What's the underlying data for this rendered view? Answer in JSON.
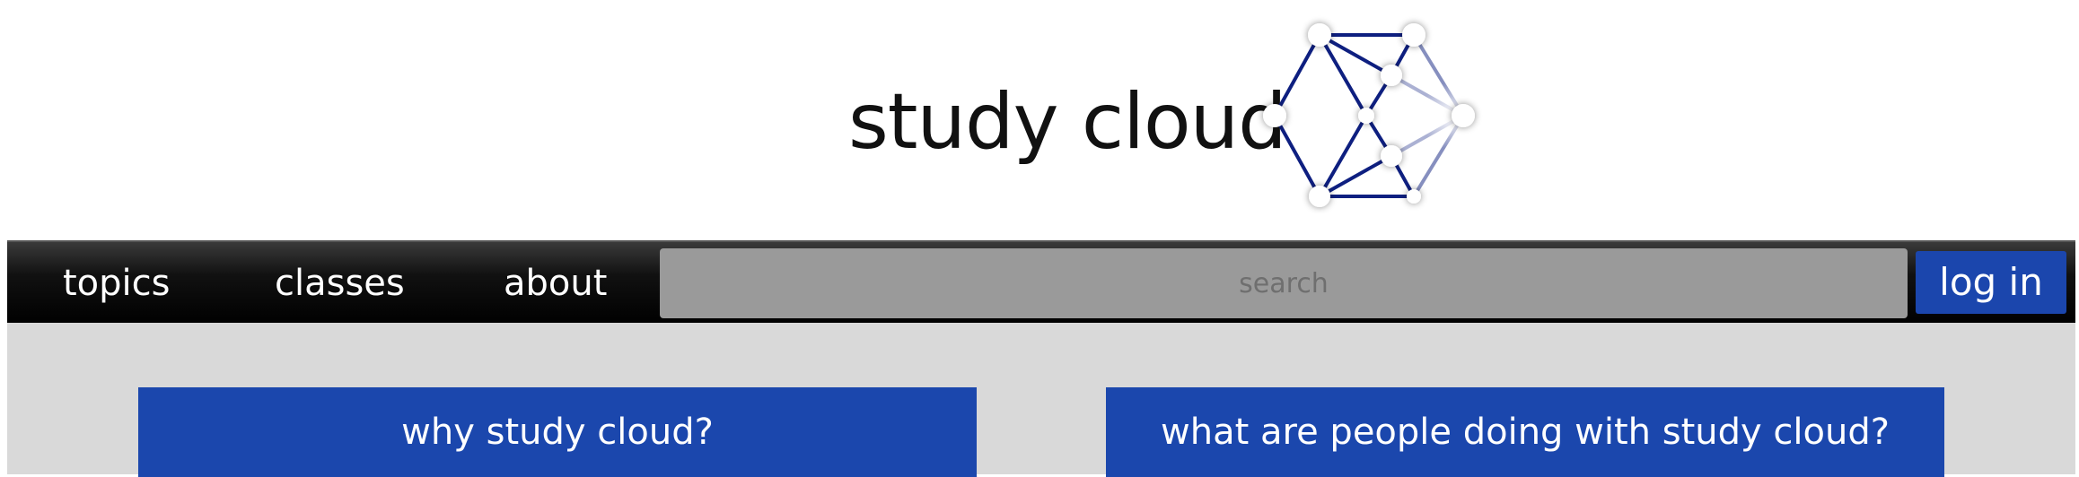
{
  "brand": {
    "name": "study cloud"
  },
  "nav": {
    "items": [
      {
        "label": "topics"
      },
      {
        "label": "classes"
      },
      {
        "label": "about"
      }
    ],
    "search": {
      "placeholder": "search",
      "value": ""
    },
    "login_label": "log in"
  },
  "cards": [
    {
      "title": "why study cloud?"
    },
    {
      "title": "what are people doing with study cloud?"
    }
  ],
  "colors": {
    "accent_blue": "#1b47ad",
    "logo_line": "#0e1f80",
    "search_bg": "#9a9a9a",
    "main_bg": "#d9d9d9",
    "navbar_bg": "#000000"
  },
  "icons": {
    "logo": "network-hexagon-icon"
  }
}
